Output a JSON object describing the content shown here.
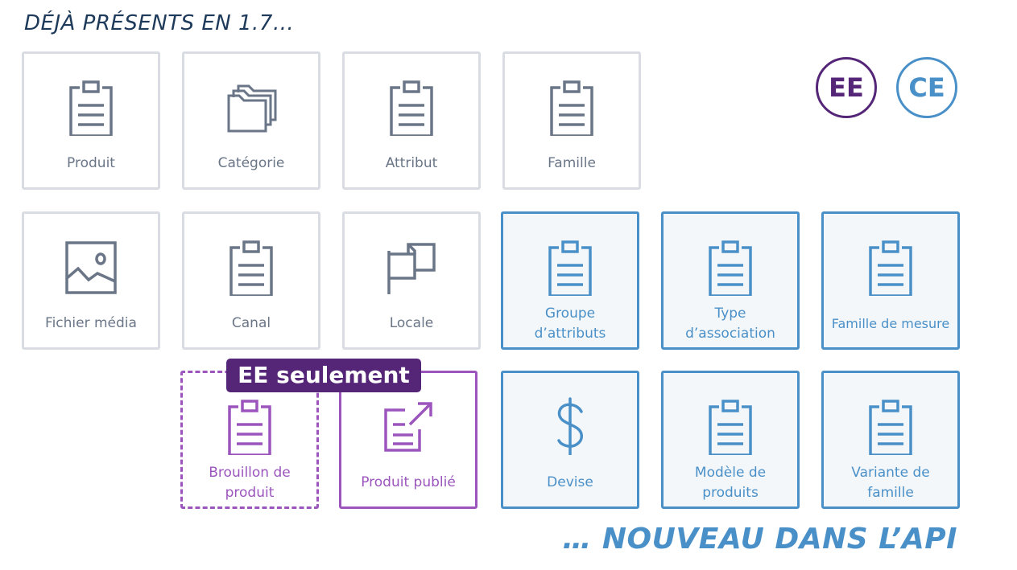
{
  "header": {
    "title": "DÉJÀ PRÉSENTS EN 1.7…"
  },
  "footer": {
    "text": "… NOUVEAU DANS L’API"
  },
  "legend": {
    "ee": {
      "label": "EE",
      "color": "#552678"
    },
    "ce": {
      "label": "CE",
      "color": "#4a90c8"
    }
  },
  "badge": {
    "label": "EE seulement",
    "color": "#552678"
  },
  "colors": {
    "existing": "#6a7687",
    "new": "#4a90c8",
    "ee_only": "#9b55bd"
  },
  "tiles": [
    {
      "label": "Produit",
      "icon": "clipboard-icon",
      "group": "existing"
    },
    {
      "label": "Catégorie",
      "icon": "folders-icon",
      "group": "existing"
    },
    {
      "label": "Attribut",
      "icon": "clipboard-icon",
      "group": "existing"
    },
    {
      "label": "Famille",
      "icon": "clipboard-icon",
      "group": "existing"
    },
    {
      "label": "Fichier média",
      "icon": "image-icon",
      "group": "existing"
    },
    {
      "label": "Canal",
      "icon": "clipboard-icon",
      "group": "existing"
    },
    {
      "label": "Locale",
      "icon": "flag-icon",
      "group": "existing"
    },
    {
      "label": "Groupe d’attributs",
      "label_lines": [
        "Groupe",
        "d’attributs"
      ],
      "icon": "clipboard-icon",
      "group": "new"
    },
    {
      "label": "Type d’association",
      "label_lines": [
        "Type",
        "d’association"
      ],
      "icon": "clipboard-icon",
      "group": "new"
    },
    {
      "label": "Famille de mesure",
      "icon": "clipboard-icon",
      "group": "new"
    },
    {
      "label": "Brouillon de produit",
      "label_lines": [
        "Brouillon de",
        "produit"
      ],
      "icon": "clipboard-icon",
      "group": "ee_only"
    },
    {
      "label": "Produit publié",
      "icon": "publish-icon",
      "group": "ee_only"
    },
    {
      "label": "Devise",
      "icon": "dollar-icon",
      "group": "new"
    },
    {
      "label": "Modèle de produits",
      "label_lines": [
        "Modèle de",
        "produits"
      ],
      "icon": "clipboard-icon",
      "group": "new"
    },
    {
      "label": "Variante de famille",
      "label_lines": [
        "Variante de",
        "famille"
      ],
      "icon": "clipboard-icon",
      "group": "new"
    }
  ]
}
